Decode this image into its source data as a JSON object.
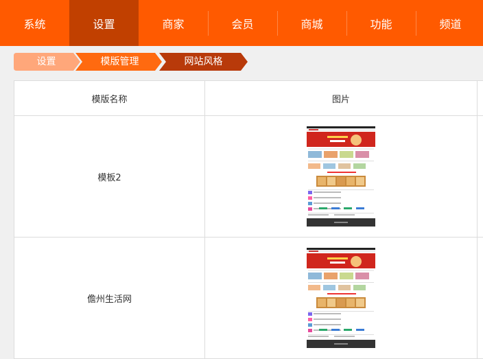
{
  "topnav": {
    "items": [
      {
        "label": "系统"
      },
      {
        "label": "设置",
        "active": true
      },
      {
        "label": "商家"
      },
      {
        "label": "会员"
      },
      {
        "label": "商城"
      },
      {
        "label": "功能"
      },
      {
        "label": "频道"
      }
    ]
  },
  "breadcrumb": {
    "items": [
      "设置",
      "模版管理",
      "网站风格"
    ],
    "colors": [
      "#ffa77a",
      "#ff6a10",
      "#b83a0a"
    ]
  },
  "table": {
    "headers": [
      "模版名称",
      "图片"
    ],
    "rows": [
      {
        "name": "模板2",
        "image": "template-preview-thumbnail"
      },
      {
        "name": "儋州生活网",
        "image": "template-preview-thumbnail"
      }
    ]
  },
  "colors": {
    "nav_bg": "#ff5a00",
    "nav_active": "#c14000",
    "border": "#dcdcdc"
  }
}
